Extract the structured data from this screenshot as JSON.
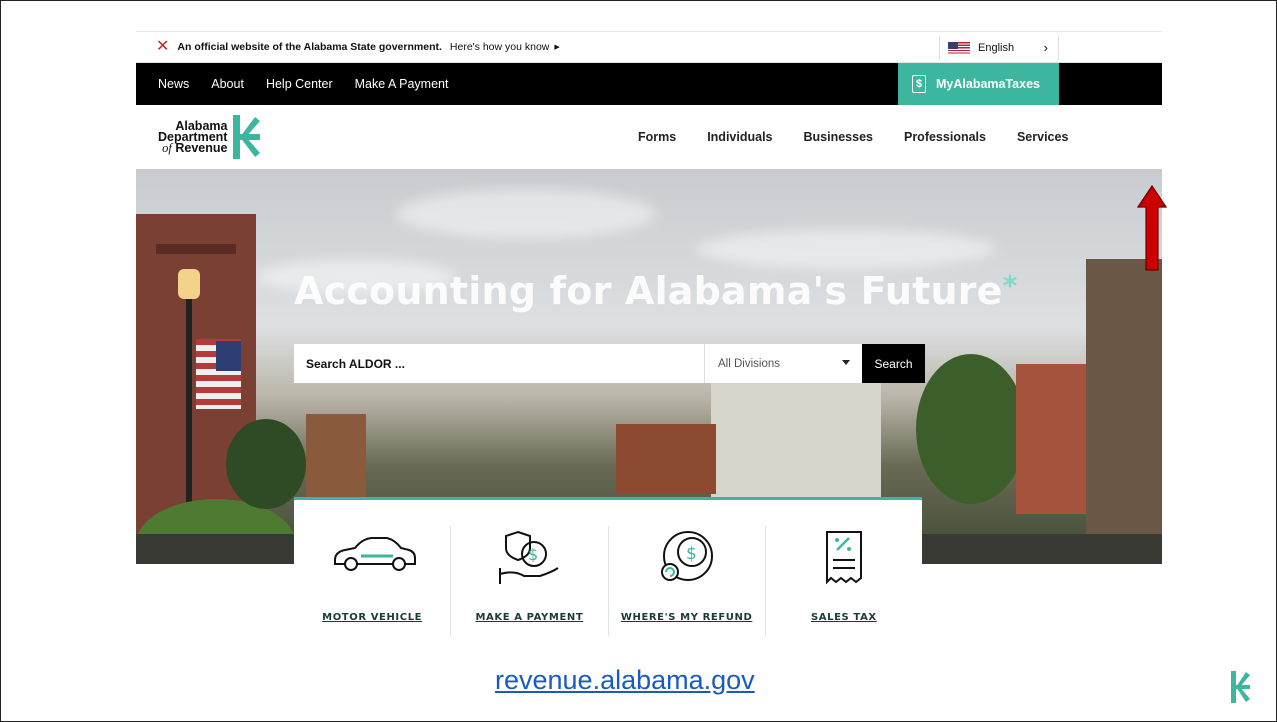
{
  "gov_banner": {
    "official_text": "An official website of the Alabama State government.",
    "how_you_know": "Here's how you know",
    "language": "English"
  },
  "top_nav": {
    "items": [
      "News",
      "About",
      "Help Center",
      "Make A Payment"
    ],
    "my_alabama_taxes": "MyAlabamaTaxes"
  },
  "logo": {
    "line1": "Alabama",
    "line2": "Department",
    "line3_of": "of",
    "line3_rest": "Revenue"
  },
  "main_nav": {
    "items": [
      "Forms",
      "Individuals",
      "Businesses",
      "Professionals",
      "Services"
    ]
  },
  "hero": {
    "title": "Accounting for Alabama's Future",
    "search_placeholder": "Search ALDOR ...",
    "division_selected": "All Divisions",
    "search_button": "Search"
  },
  "quick_links": [
    {
      "label": "MOTOR VEHICLE",
      "icon": "car-icon"
    },
    {
      "label": "MAKE A PAYMENT",
      "icon": "hand-dollar-icon"
    },
    {
      "label": "WHERE'S MY REFUND",
      "icon": "refund-coin-icon"
    },
    {
      "label": "SALES TAX",
      "icon": "receipt-icon"
    }
  ],
  "footer_link": "revenue.alabama.gov",
  "colors": {
    "accent": "#3db6a0",
    "annotation_arrow": "#cc0000",
    "link": "#1a5bbf"
  }
}
